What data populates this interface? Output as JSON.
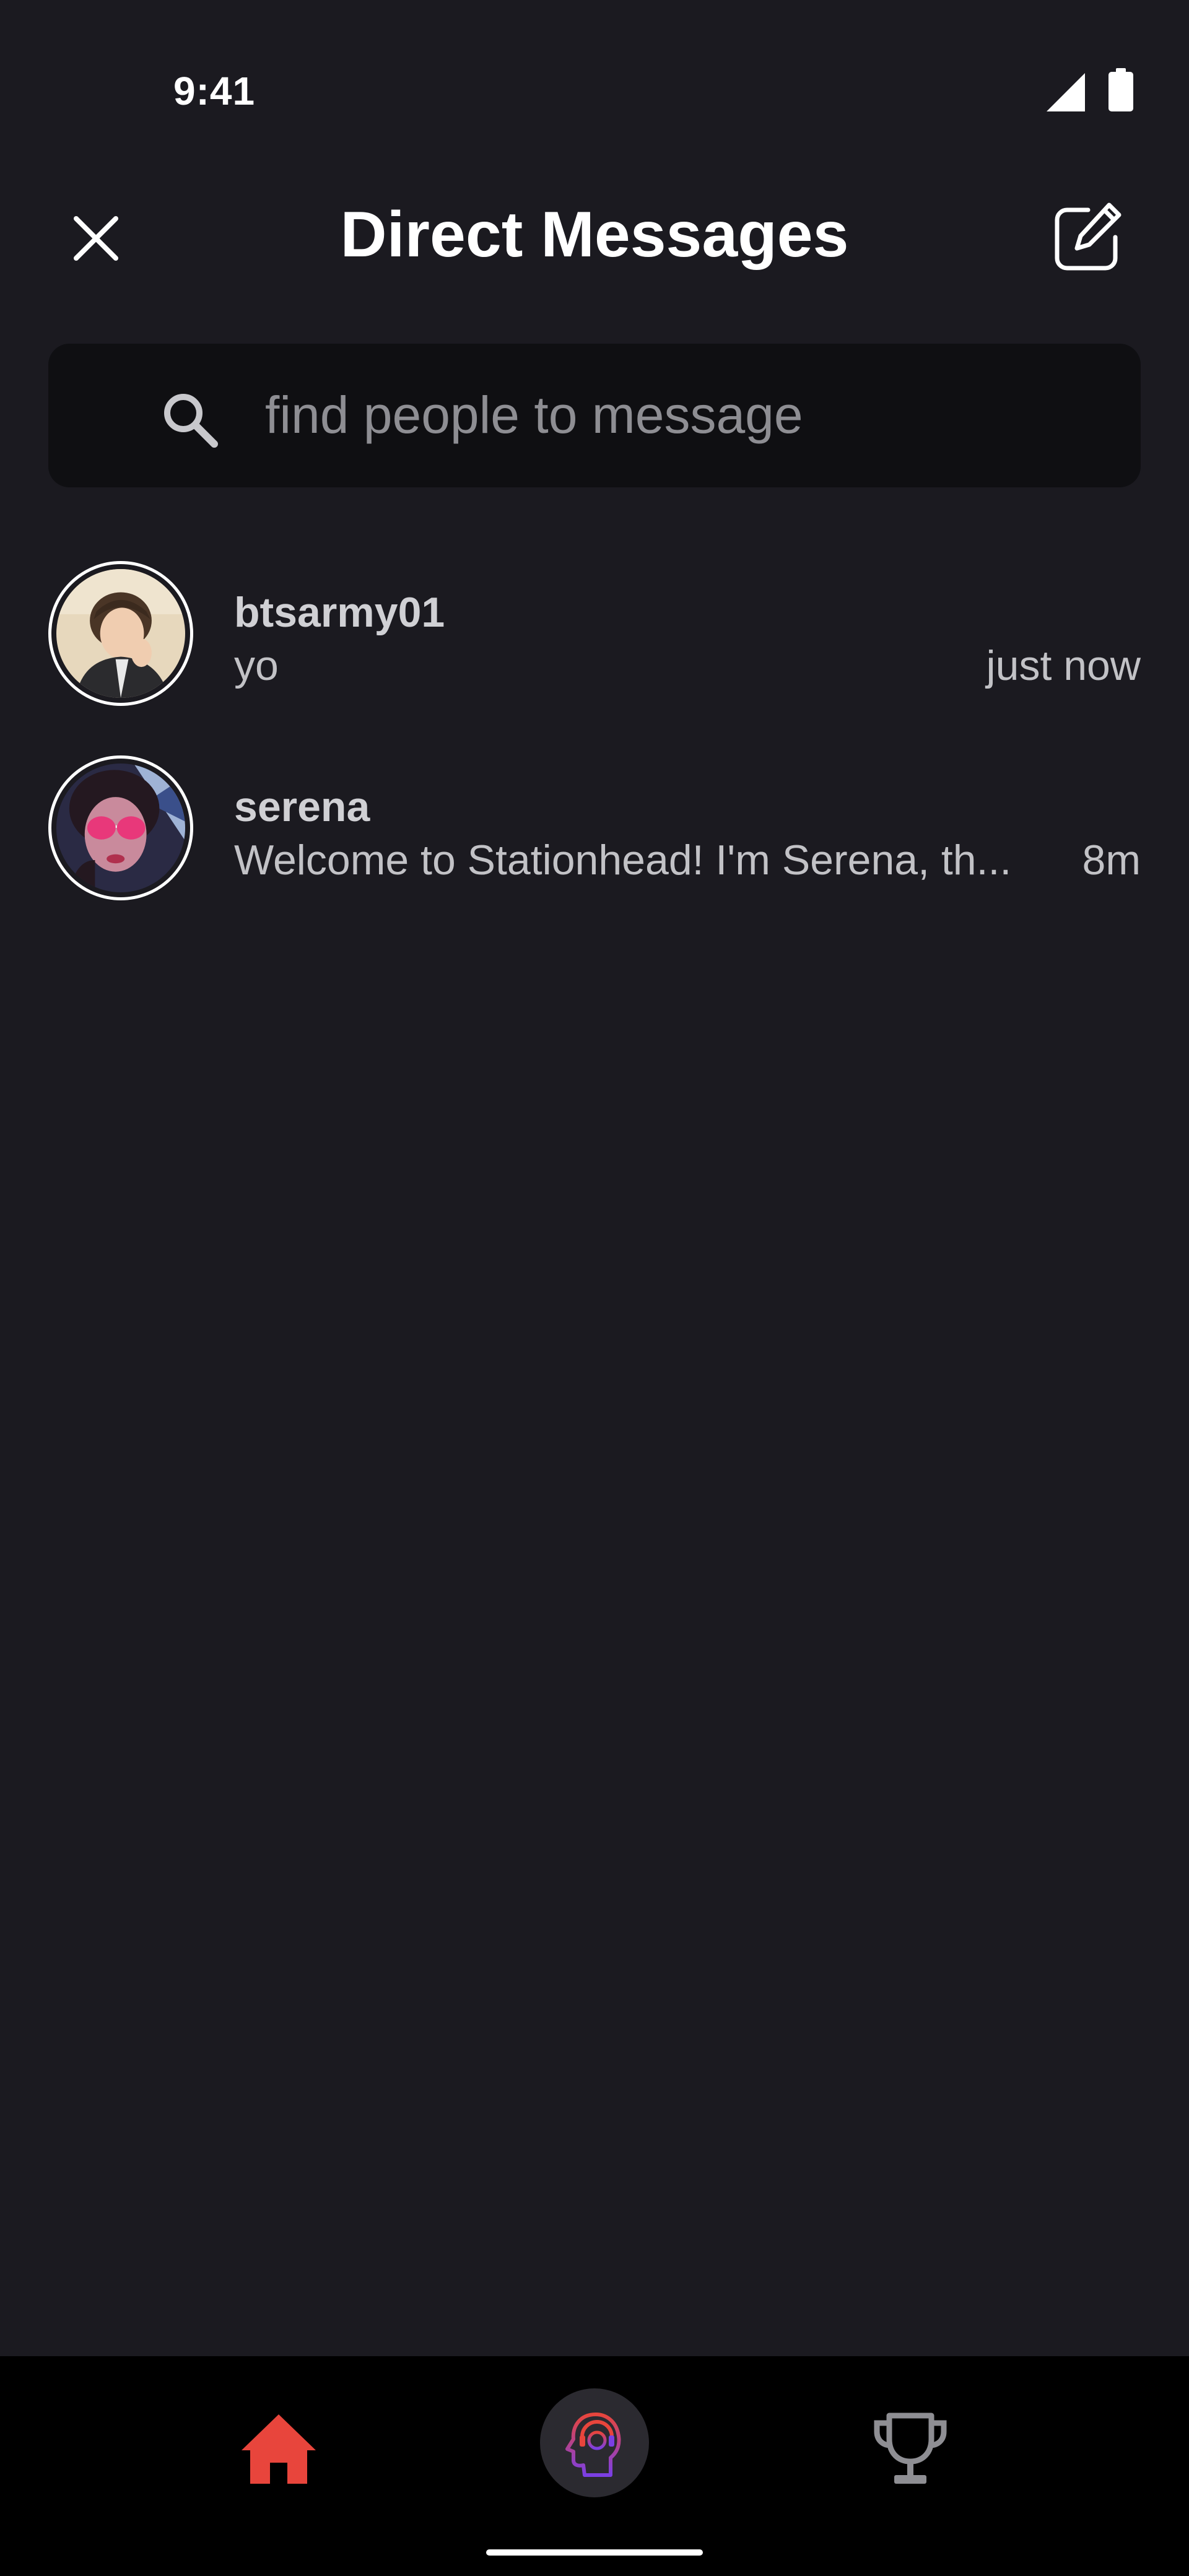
{
  "status_bar": {
    "time": "9:41",
    "icons": [
      "signal-icon",
      "battery-icon"
    ]
  },
  "header": {
    "title": "Direct Messages",
    "close_icon": "close-icon",
    "compose_icon": "compose-icon"
  },
  "search": {
    "placeholder": "find people to message",
    "value": "",
    "icon": "search-icon"
  },
  "conversations": [
    {
      "name": "btsarmy01",
      "preview": "yo",
      "time": "just now"
    },
    {
      "name": "serena",
      "preview": "Welcome to Stationhead! I'm Serena, th...",
      "time": "8m"
    }
  ],
  "bottom_nav": {
    "items": [
      "home-icon",
      "station-icon",
      "trophy-icon"
    ],
    "active": "home-icon"
  },
  "colors": {
    "background": "#1b1a20",
    "search_background": "#0f0f12",
    "accent_red": "#e8453c",
    "accent_purple": "#7b3fe4",
    "nav_background": "#000000",
    "muted_text": "#c2c2c6"
  }
}
